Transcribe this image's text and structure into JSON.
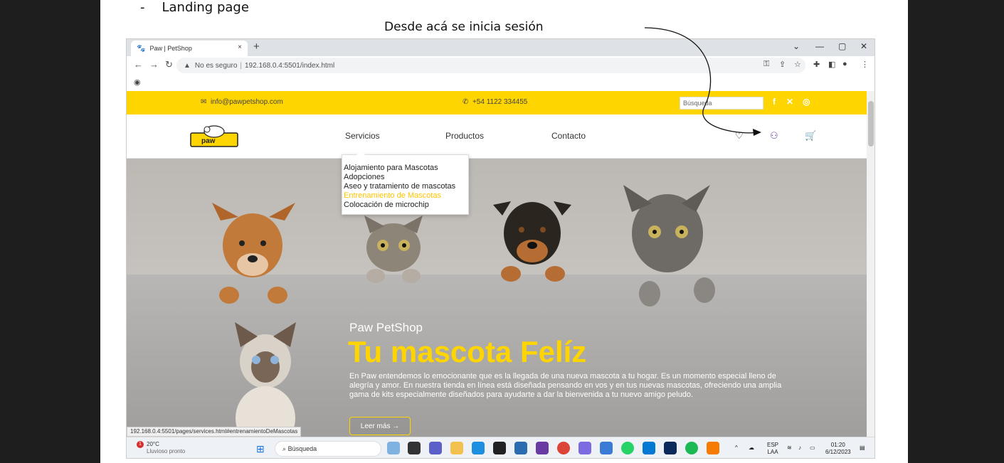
{
  "document": {
    "bullet_dash": "-",
    "bullet_text": "Landing page",
    "annotation": "Desde acá se inicia sesión"
  },
  "browser": {
    "tab_title": "Paw | PetShop",
    "tab_close": "×",
    "new_tab": "+",
    "security_label": "No es seguro",
    "url": "192.168.0.4:5501/index.html",
    "status_url": "192.168.0.4:5501/pages/services.html#entrenamientoDeMascotas"
  },
  "site": {
    "email": "info@pawpetshop.com",
    "phone": "+54 1122 334455",
    "search_placeholder": "Búsqueda",
    "logo_text": "paw",
    "nav": [
      "Servicios",
      "Productos",
      "Contacto"
    ],
    "dropdown": [
      "Alojamiento para Mascotas",
      "Adopciones",
      "Aseo y tratamiento de mascotas",
      "Entrenamiento de Mascotas",
      "Colocación de microchip"
    ],
    "hero": {
      "brand": "Paw PetShop",
      "headline": "Tu mascota Felíz",
      "description": "En Paw entendemos lo emocionante que es la llegada de una nueva mascota a tu hogar. Es un momento especial lleno de alegría y amor. En nuestra tienda en línea está diseñada pensando en vos y en tus nuevas mascotas, ofreciendo una amplia gama de kits especialmente diseñados para ayudarte a dar la bienvenida a tu nuevo amigo peludo.",
      "button": "Leer más →"
    },
    "colors": {
      "accent": "#ffd500",
      "highlight": "#ffc400"
    }
  },
  "taskbar": {
    "weather_temp": "20°C",
    "weather_text": "Lluvioso pronto",
    "weather_badge": "1",
    "search": "Búsqueda",
    "lang_top": "ESP",
    "lang_bottom": "LAA",
    "time": "01:20",
    "date": "6/12/2023"
  }
}
